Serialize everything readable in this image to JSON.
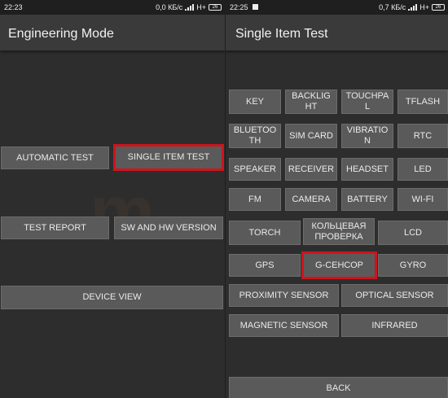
{
  "left_phone": {
    "status": {
      "time": "22:23",
      "speed": "0,0 КБ/с",
      "network": "H+",
      "battery": "26"
    },
    "title": "Engineering Mode",
    "buttons": {
      "automatic_test": "AUTOMATIC TEST",
      "single_item_test": "SINGLE ITEM TEST",
      "test_report": "TEST REPORT",
      "sw_hw_version": "SW AND HW VERSION",
      "device_view": "DEVICE VIEW"
    }
  },
  "right_phone": {
    "status": {
      "time": "22:25",
      "speed": "0,7 КБ/с",
      "network": "H+",
      "battery": "26"
    },
    "title": "Single Item Test",
    "buttons": {
      "key": "KEY",
      "backlight": "BACKLIG HT",
      "touchpal": "TOUCHPA L",
      "tflash": "TFLASH",
      "bluetooth": "BLUETOO TH",
      "sim_card": "SIM CARD",
      "vibration": "VIBRATIO N",
      "rtc": "RTC",
      "speaker": "SPEAKER",
      "receiver": "RECEIVER",
      "headset": "HEADSET",
      "led": "LED",
      "fm": "FM",
      "camera": "CAMERA",
      "battery": "BATTERY",
      "wifi": "WI-FI",
      "torch": "TORCH",
      "circular_check": "КОЛЬЦЕВАЯ ПРОВЕРКА",
      "lcd": "LCD",
      "gps": "GPS",
      "g_sensor": "G-СЕНСОР",
      "gyro": "GYRO",
      "proximity_sensor": "PROXIMITY SENSOR",
      "optical_sensor": "OPTICAL SENSOR",
      "magnetic_sensor": "MAGNETIC SENSOR",
      "infrared": "INFRARED",
      "back": "BACK"
    }
  },
  "colors": {
    "background": "#2d2d2d",
    "button": "#5a5a5a",
    "highlight": "#d0131c"
  }
}
